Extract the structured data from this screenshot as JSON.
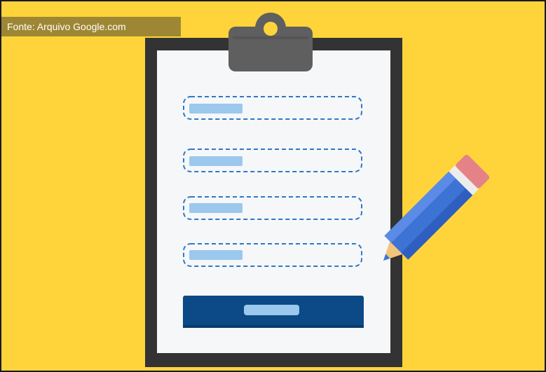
{
  "caption": {
    "text": "Fonte: Arquivo Google.com"
  },
  "colors": {
    "background": "#FFD43A",
    "clipboard_board": "#333333",
    "paper": "#F6F7F9",
    "clip": "#5F5F5F",
    "field_border": "#2F78C4",
    "field_placeholder": "#9BC8EC",
    "submit_button": "#0B4A86",
    "pencil_body": "#3E73D6",
    "pencil_eraser": "#E48288",
    "pencil_wood": "#F2C57C"
  },
  "form": {
    "fields": [
      {
        "icon": "text-field"
      },
      {
        "icon": "text-field"
      },
      {
        "icon": "text-field"
      },
      {
        "icon": "text-field"
      }
    ],
    "submit": {
      "icon": "submit-button"
    }
  },
  "decorations": [
    "clipboard-icon",
    "pencil-icon"
  ]
}
